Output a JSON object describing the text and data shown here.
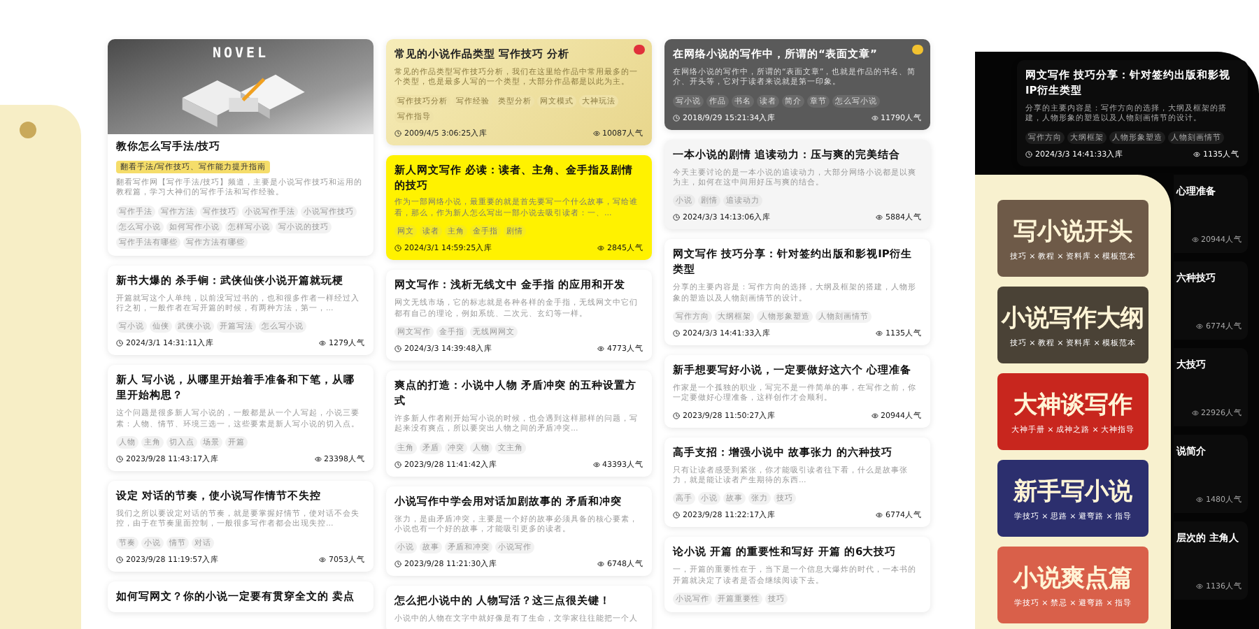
{
  "columns": [
    {
      "cards": [
        {
          "kind": "image",
          "header_text": "NOVEL",
          "title": "教你怎么写手法/技巧",
          "label": "翻看手法/写作技巧、写作能力提升指南",
          "excerpt": "翻看写作网【写作手法/技巧】频道，主要是小说写作技巧和运用的教程篇，学习大神们的写作手法和写作经验。",
          "tags": [
            "写作手法",
            "写作方法",
            "写作技巧",
            "小说写作手法",
            "小说写作技巧",
            "怎么写小说",
            "如何写作小说",
            "怎样写小说",
            "写小说的技巧",
            "写作手法有哪些",
            "写作方法有哪些"
          ]
        },
        {
          "kind": "plain",
          "title": "新书大爆的 **杀手锏**：武侠仙侠小说开篇就玩梗",
          "excerpt": "开篇就写这个人单纯，以前没写过书的，也和很多作者一样经过入行之初，一般作者在写开篇的时候，有两种方法，第一，...",
          "tags": [
            "写小说",
            "仙侠",
            "武侠小说",
            "开篇写法",
            "怎么写小说"
          ],
          "date": "2024/3/1 14:31:11入库",
          "views": "1279人气"
        },
        {
          "kind": "plain",
          "title": "新人 **写小说**，从哪里开始着手准备和下笔，从哪里开始构思？",
          "excerpt": "这个问题是很多新人写小说的，一般都是从一个人写起，小说三要素：人物、情节、环境三选一，这些要素是新人写小说的切入点。",
          "tags": [
            "人物",
            "主角",
            "切入点",
            "场景",
            "开篇"
          ],
          "date": "2023/9/28 11:43:17入库",
          "views": "23398人气"
        },
        {
          "kind": "plain",
          "title": "设定 **对话的节奏**，使小说写作情节不失控",
          "excerpt": "我们之所以要设定对话的节奏，就是要掌握好情节，使对话不会失控，由于在节奏里面控制，一般很多写作者都会出现失控...",
          "tags": [
            "节奏",
            "小说",
            "情节",
            "对话"
          ],
          "date": "2023/9/28 11:19:57入库",
          "views": "7053人气"
        },
        {
          "kind": "plain",
          "title": "如何写网文？你的小说一定要有贯穿全文的 **卖点**"
        }
      ]
    },
    {
      "cards": [
        {
          "kind": "gold",
          "badge": {
            "color": "#e0303a"
          },
          "title": "常见的小说作品类型 **写作技巧** 分析",
          "excerpt": "常见的作品类型写作技巧分析，我们在这里给作品中常用最多的一个类型，也是最多人写的一个类型，大部分作品都是以此为主。",
          "tags": [
            "写作技巧分析",
            "写作经验",
            "类型分析",
            "网文模式",
            "大神玩法",
            "写作指导"
          ],
          "date": "2009/4/5 3:06:25入库",
          "views": "10087人气"
        },
        {
          "kind": "yellow",
          "title": "**新人网文写作** 必读：读者、主角、金手指及剧情的技巧",
          "excerpt": "作为一部网络小说，最重要的就是首先要写一个什么故事，写给谁看，那么，作为新人怎么写出一部小说去吸引读者：一、...",
          "tags": [
            "网文",
            "读者",
            "主角",
            "金手指",
            "剧情"
          ],
          "date": "2024/3/1 14:59:25入库",
          "views": "2845人气"
        },
        {
          "kind": "plain",
          "title": "网文写作：浅析无线文中 **金手指** 的应用和开发",
          "excerpt": "网文无线市场，它的标志就是各种各样的金手指，无线网文中它们都有自己的理论，例如系统、二次元、玄幻等一样。",
          "tags": [
            "网文写作",
            "金手指",
            "无线网网文"
          ],
          "date": "2024/3/3 14:39:48入库",
          "views": "4773人气"
        },
        {
          "kind": "plain",
          "title": "爽点的打造：小说中人物 **矛盾冲突** 的五种设置方式",
          "excerpt": "许多新人作者刚开始写小说的时候，也会遇到这样那样的问题，写起来没有爽点，所以要突出人物之间的矛盾冲突...",
          "tags": [
            "主角",
            "矛盾",
            "冲突",
            "人物",
            "文主角"
          ],
          "date": "2023/9/28 11:41:42入库",
          "views": "43393人气"
        },
        {
          "kind": "plain",
          "title": "小说写作中学会用对话加剧故事的 **矛盾和冲突**",
          "excerpt": "张力，是由矛盾冲突，主要是一个好的故事必须具备的核心要素，小说也有一个好的故事，才能吸引更多的读者。",
          "tags": [
            "小说",
            "故事",
            "矛盾和冲突",
            "小说写作"
          ],
          "date": "2023/9/28 11:21:30入库",
          "views": "6748人气"
        },
        {
          "kind": "plain",
          "title": "怎么把小说中的 **人物写活**？这三点很关键！",
          "excerpt": "小说中的人物在文字中就好像是有了生命，文学家往往能把一个人"
        }
      ]
    },
    {
      "cards": [
        {
          "kind": "dark",
          "badge": {
            "color": "#f2c230"
          },
          "title": "在网络小说的写作中，所谓的“**表面文章**”",
          "excerpt": "在网络小说的写作中，所谓的“表面文章”，也就是作品的书名、简介、开头等，它对于读者来说就是第一印象。",
          "tags": [
            "写小说",
            "作品",
            "书名",
            "读者",
            "简介",
            "章节",
            "怎么写小说"
          ],
          "date": "2018/9/29 15:21:34入库",
          "views": "11790人气"
        },
        {
          "kind": "grey",
          "title": "一本小说的剧情 **追读动力**：压与爽的完美结合",
          "excerpt": "今天主要讨论的是一本小说的追读动力，大部分网络小说都是以爽为主，如何在这中间用好压与爽的结合。",
          "tags": [
            "小说",
            "剧情",
            "追读动力"
          ],
          "date": "2024/3/3 14:13:06入库",
          "views": "5884人气"
        },
        {
          "kind": "plain",
          "title": "**网文写作** 技巧分享：针对签约出版和影视IP衍生类型",
          "excerpt": "分享的主要内容是：写作方向的选择，大纲及框架的搭建，人物形象的塑造以及人物刻画情节的设计。",
          "tags": [
            "写作方向",
            "大纲框架",
            "人物形象塑造",
            "人物刻画情节"
          ],
          "date": "2024/3/3 14:41:33入库",
          "views": "1135人气"
        },
        {
          "kind": "plain",
          "title": "新手想要写好小说，一定要做好这六个 **心理准备**",
          "excerpt": "作家是一个孤独的职业，写完不是一件简单的事，在写作之前，你一定要做好心理准备，这样创作才会顺利。",
          "date": "2023/9/28 11:50:27入库",
          "views": "20944人气"
        },
        {
          "kind": "plain",
          "title": "高手支招：增强小说中 **故事张力** 的六种技巧",
          "excerpt": "只有让读者感受到紧张，你才能吸引读者往下看，什么是故事张力，就是能让读者产生期待的东西...",
          "tags": [
            "高手",
            "小说",
            "故事",
            "张力",
            "技巧"
          ],
          "date": "2023/9/28 11:22:17入库",
          "views": "6774人气"
        },
        {
          "kind": "plain",
          "title": "论小说 **开篇** 的重要性和写好 **开篇** 的6大技巧",
          "excerpt": "一，开篇的重要性在于，当下是一个信息大爆炸的时代，一本书的开篇就决定了读者是否会继续阅读下去。",
          "tags": [
            "小说写作",
            "开篇重要性",
            "技巧"
          ]
        }
      ]
    }
  ],
  "side_panel": {
    "card": {
      "kind": "black",
      "title": "**网文写作** 技巧分享：针对签约出版和影视IP衍生类型",
      "excerpt": "分享的主要内容是：写作方向的选择，大纲及框架的搭建，人物形象的塑造以及人物刻画情节的设计。",
      "tags": [
        "写作方向",
        "大纲框架",
        "人物形象塑造",
        "人物刻画情节"
      ],
      "date": "2024/3/3 14:41:33入库",
      "views": "1135人气"
    },
    "peeks": [
      {
        "title": "**心理准备**",
        "views": "20944人气"
      },
      {
        "title": "六种技巧",
        "views": "6774人气"
      },
      {
        "title": "大技巧",
        "views": "22926人气"
      },
      {
        "title": "说简介",
        "views": "1480人气"
      },
      {
        "title": "层次的 **主角人**",
        "views": "1136人气"
      }
    ]
  },
  "banners": [
    {
      "title": "写小说开头",
      "subtitle": "技巧 × 教程 × 资料库 × 模板范本",
      "color": "#6e5a48"
    },
    {
      "title": "小说写作大纲",
      "subtitle": "技巧 × 教程 × 资料库 × 模板范本",
      "color": "#4a4236"
    },
    {
      "title": "大神谈写作",
      "subtitle": "大神手册 × 成神之路 × 大神指导",
      "color": "#c8261e"
    },
    {
      "title": "新手写小说",
      "subtitle": "学技巧 × 思路 × 避弯路 × 指导",
      "color": "#2c2f6e"
    },
    {
      "title": "小说爽点篇",
      "subtitle": "学技巧 × 禁忌 × 避弯路 × 指导",
      "color": "#d9604a"
    }
  ]
}
